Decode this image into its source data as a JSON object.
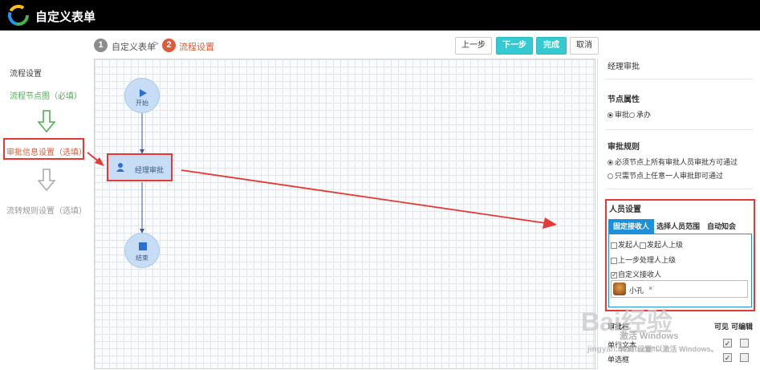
{
  "header": {
    "app_title": "自定义表单"
  },
  "steps": [
    {
      "num": "1",
      "label": "自定义表单",
      "color": "#8c8c8c"
    },
    {
      "num": "2",
      "label": "流程设置",
      "color": "#e05a3a"
    }
  ],
  "step_separator": ">",
  "toolbar": {
    "prev": "上一步",
    "next": "下一步",
    "finish": "完成",
    "cancel": "取消"
  },
  "sidebar": {
    "title": "流程设置",
    "items": [
      {
        "label": "流程节点图（必填）",
        "color": "#4caf50"
      },
      {
        "label": "审批信息设置（选填）",
        "color": "#e05a3a"
      },
      {
        "label": "流转规则设置（选填）",
        "color": "#999999"
      }
    ]
  },
  "flow": {
    "start": "开始",
    "approval": "经理审批",
    "end": "结束"
  },
  "panel": {
    "node_name": "经理审批",
    "node_attr_title": "节点属性",
    "node_attr_options": [
      "审批",
      "承办"
    ],
    "rule_title": "审批规则",
    "rule_options": [
      "必须节点上所有审批人员审批方可通过",
      "只需节点上任意一人审批即可通过"
    ],
    "person_title": "人员设置",
    "tabs": [
      "固定接收人",
      "选择人员范围",
      "自动知会"
    ],
    "checkboxes": [
      "发起人",
      "发起人上级",
      "上一步处理人上级",
      "自定义接收人"
    ],
    "selected_person": "小孔",
    "remove_symbol": "×",
    "field_header_visible": "可见",
    "field_header_editable": "可编辑",
    "field_header_title": "审批栏",
    "field_rows": [
      "单行文本",
      "单选框"
    ]
  },
  "watermark": {
    "brand": "Bai经验",
    "activate_line1": "激活 Windows",
    "activate_line2": "转到\"设置\"以激活 Windows。",
    "site": "jingyan.baidu.com"
  },
  "colors": {
    "accent": "#35c9d1",
    "highlight": "#e53935",
    "active_step": "#e05a3a"
  }
}
